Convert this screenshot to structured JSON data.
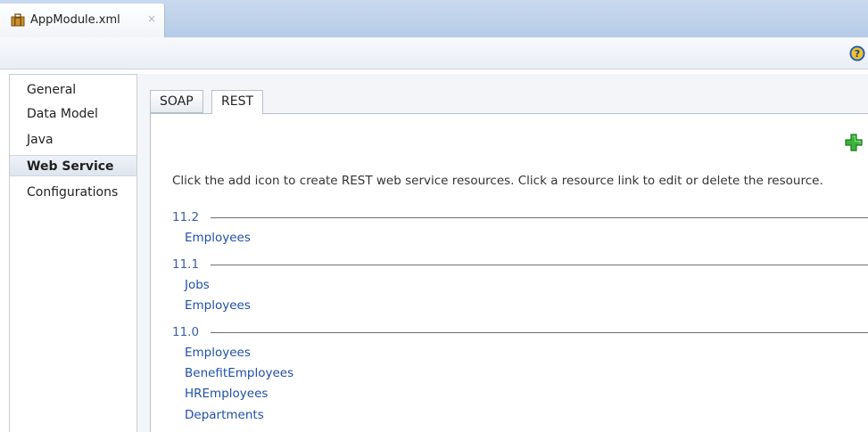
{
  "editor_tab": {
    "label": "AppModule.xml",
    "close": "×"
  },
  "nav": {
    "items": [
      {
        "label": "General"
      },
      {
        "label": "Data Model"
      },
      {
        "label": "Java"
      },
      {
        "label": "Web Service"
      },
      {
        "label": "Configurations"
      }
    ],
    "selected": "Web Service"
  },
  "subtabs": [
    {
      "label": "SOAP"
    },
    {
      "label": "REST"
    }
  ],
  "selected_subtab": "REST",
  "instructions": "Click the add icon to create REST web service resources. Click a resource link to edit or delete the resource.",
  "versions": [
    {
      "label": "11.2",
      "resources": [
        "Employees"
      ]
    },
    {
      "label": "11.1",
      "resources": [
        "Jobs",
        "Employees"
      ]
    },
    {
      "label": "11.0",
      "resources": [
        "Employees",
        "BenefitEmployees",
        "HREmployees",
        "Departments"
      ]
    }
  ],
  "icons": {
    "file": "app-module-icon",
    "close": "close-icon",
    "help": "help-icon",
    "add": "add-icon"
  },
  "colors": {
    "tab_strip": "#c9d9ee",
    "link": "#1f4fa8",
    "version_label": "#3a5fa8",
    "add_icon": "#2ea52e",
    "help_icon": "#2f6fcf"
  }
}
